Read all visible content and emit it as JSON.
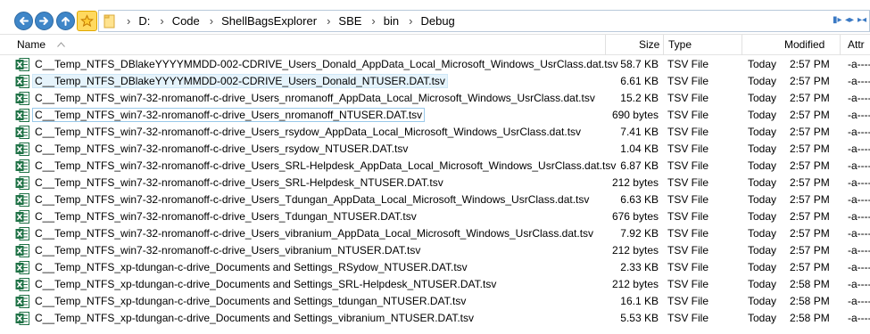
{
  "address": {
    "segments": [
      "D:",
      "Code",
      "ShellBagsExplorer",
      "SBE",
      "bin",
      "Debug"
    ]
  },
  "columns": {
    "name": "Name",
    "size": "Size",
    "type": "Type",
    "modified": "Modified",
    "attributes": "Attr"
  },
  "files": [
    {
      "name": "C__Temp_NTFS_DBlakeYYYYMMDD-002-CDRIVE_Users_Donald_AppData_Local_Microsoft_Windows_UsrClass.dat.tsv",
      "size": "58.7 KB",
      "type": "TSV File",
      "day": "Today",
      "time": "2:57 PM",
      "attr": "-a----"
    },
    {
      "name": "C__Temp_NTFS_DBlakeYYYYMMDD-002-CDRIVE_Users_Donald_NTUSER.DAT.tsv",
      "size": "6.61 KB",
      "type": "TSV File",
      "day": "Today",
      "time": "2:57 PM",
      "attr": "-a----"
    },
    {
      "name": "C__Temp_NTFS_win7-32-nromanoff-c-drive_Users_nromanoff_AppData_Local_Microsoft_Windows_UsrClass.dat.tsv",
      "size": "15.2 KB",
      "type": "TSV File",
      "day": "Today",
      "time": "2:57 PM",
      "attr": "-a----"
    },
    {
      "name": "C__Temp_NTFS_win7-32-nromanoff-c-drive_Users_nromanoff_NTUSER.DAT.tsv",
      "size": "690 bytes",
      "type": "TSV File",
      "day": "Today",
      "time": "2:57 PM",
      "attr": "-a----"
    },
    {
      "name": "C__Temp_NTFS_win7-32-nromanoff-c-drive_Users_rsydow_AppData_Local_Microsoft_Windows_UsrClass.dat.tsv",
      "size": "7.41 KB",
      "type": "TSV File",
      "day": "Today",
      "time": "2:57 PM",
      "attr": "-a----"
    },
    {
      "name": "C__Temp_NTFS_win7-32-nromanoff-c-drive_Users_rsydow_NTUSER.DAT.tsv",
      "size": "1.04 KB",
      "type": "TSV File",
      "day": "Today",
      "time": "2:57 PM",
      "attr": "-a----"
    },
    {
      "name": "C__Temp_NTFS_win7-32-nromanoff-c-drive_Users_SRL-Helpdesk_AppData_Local_Microsoft_Windows_UsrClass.dat.tsv",
      "size": "6.87 KB",
      "type": "TSV File",
      "day": "Today",
      "time": "2:57 PM",
      "attr": "-a----"
    },
    {
      "name": "C__Temp_NTFS_win7-32-nromanoff-c-drive_Users_SRL-Helpdesk_NTUSER.DAT.tsv",
      "size": "212 bytes",
      "type": "TSV File",
      "day": "Today",
      "time": "2:57 PM",
      "attr": "-a----"
    },
    {
      "name": "C__Temp_NTFS_win7-32-nromanoff-c-drive_Users_Tdungan_AppData_Local_Microsoft_Windows_UsrClass.dat.tsv",
      "size": "6.63 KB",
      "type": "TSV File",
      "day": "Today",
      "time": "2:57 PM",
      "attr": "-a----"
    },
    {
      "name": "C__Temp_NTFS_win7-32-nromanoff-c-drive_Users_Tdungan_NTUSER.DAT.tsv",
      "size": "676 bytes",
      "type": "TSV File",
      "day": "Today",
      "time": "2:57 PM",
      "attr": "-a----"
    },
    {
      "name": "C__Temp_NTFS_win7-32-nromanoff-c-drive_Users_vibranium_AppData_Local_Microsoft_Windows_UsrClass.dat.tsv",
      "size": "7.92 KB",
      "type": "TSV File",
      "day": "Today",
      "time": "2:57 PM",
      "attr": "-a----"
    },
    {
      "name": "C__Temp_NTFS_win7-32-nromanoff-c-drive_Users_vibranium_NTUSER.DAT.tsv",
      "size": "212 bytes",
      "type": "TSV File",
      "day": "Today",
      "time": "2:57 PM",
      "attr": "-a----"
    },
    {
      "name": "C__Temp_NTFS_xp-tdungan-c-drive_Documents and Settings_RSydow_NTUSER.DAT.tsv",
      "size": "2.33 KB",
      "type": "TSV File",
      "day": "Today",
      "time": "2:57 PM",
      "attr": "-a----"
    },
    {
      "name": "C__Temp_NTFS_xp-tdungan-c-drive_Documents and Settings_SRL-Helpdesk_NTUSER.DAT.tsv",
      "size": "212 bytes",
      "type": "TSV File",
      "day": "Today",
      "time": "2:58 PM",
      "attr": "-a----"
    },
    {
      "name": "C__Temp_NTFS_xp-tdungan-c-drive_Documents and Settings_tdungan_NTUSER.DAT.tsv",
      "size": "16.1 KB",
      "type": "TSV File",
      "day": "Today",
      "time": "2:58 PM",
      "attr": "-a----"
    },
    {
      "name": "C__Temp_NTFS_xp-tdungan-c-drive_Documents and Settings_vibranium_NTUSER.DAT.tsv",
      "size": "5.53 KB",
      "type": "TSV File",
      "day": "Today",
      "time": "2:58 PM",
      "attr": "-a----"
    }
  ],
  "colors": {
    "nav_button": "#3f86c8",
    "favorites": "#ffd95e",
    "hover_row": "#e5f3fb",
    "excel_green": "#1e7145"
  },
  "icons": {
    "back": "arrow-left-icon",
    "forward": "arrow-right-icon",
    "up": "arrow-up-icon",
    "favorites": "star-icon",
    "folder": "folder-icon",
    "file": "excel-file-icon"
  }
}
